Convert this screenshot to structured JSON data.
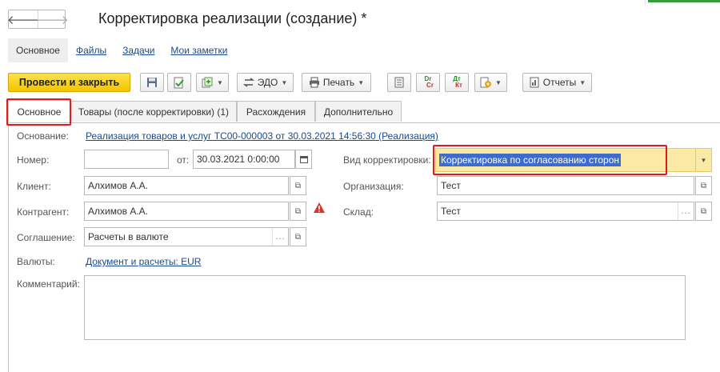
{
  "window": {
    "title": "Корректировка реализации (создание) *"
  },
  "nav": {
    "back": "🡐",
    "forward": "🡒"
  },
  "sections": [
    "Основное",
    "Файлы",
    "Задачи",
    "Мои заметки"
  ],
  "toolbar": {
    "post_close": "Провести и закрыть",
    "edo": "ЭДО",
    "print": "Печать",
    "reports": "Отчеты",
    "dt_cr_top": "Дт",
    "dt_cr_bottom": "Кт",
    "dr_cr_top": "Dr",
    "dr_cr_bottom": "Cr"
  },
  "tabs": [
    "Основное",
    "Товары (после корректировки) (1)",
    "Расхождения",
    "Дополнительно"
  ],
  "form": {
    "basis_label": "Основание:",
    "basis_value": "Реализация товаров и услуг ТС00-000003 от 30.03.2021 14:56:30 (Реализация)",
    "number_label": "Номер:",
    "number_value": "",
    "date_label": "от:",
    "date_value": "30.03.2021  0:00:00",
    "correction_type_label": "Вид корректировки:",
    "correction_type_value": "Корректировка по согласованию сторон",
    "client_label": "Клиент:",
    "client_value": "Алхимов А.А.",
    "organization_label": "Организация:",
    "organization_value": "Тест",
    "counterparty_label": "Контрагент:",
    "counterparty_value": "Алхимов А.А.",
    "warehouse_label": "Склад:",
    "warehouse_value": "Тест",
    "agreement_label": "Соглашение:",
    "agreement_value": "Расчеты в валюте",
    "currency_label": "Валюты:",
    "currency_value": "Документ и расчеты: EUR",
    "comment_label": "Комментарий:",
    "comment_value": ""
  },
  "colors": {
    "primary_button": "#f4c400",
    "link": "#1a4b8c",
    "selection": "#3c6ccd",
    "highlight_field": "#fbe9a6",
    "annotation_red": "#e01b1b",
    "warning": "#d9362b"
  }
}
